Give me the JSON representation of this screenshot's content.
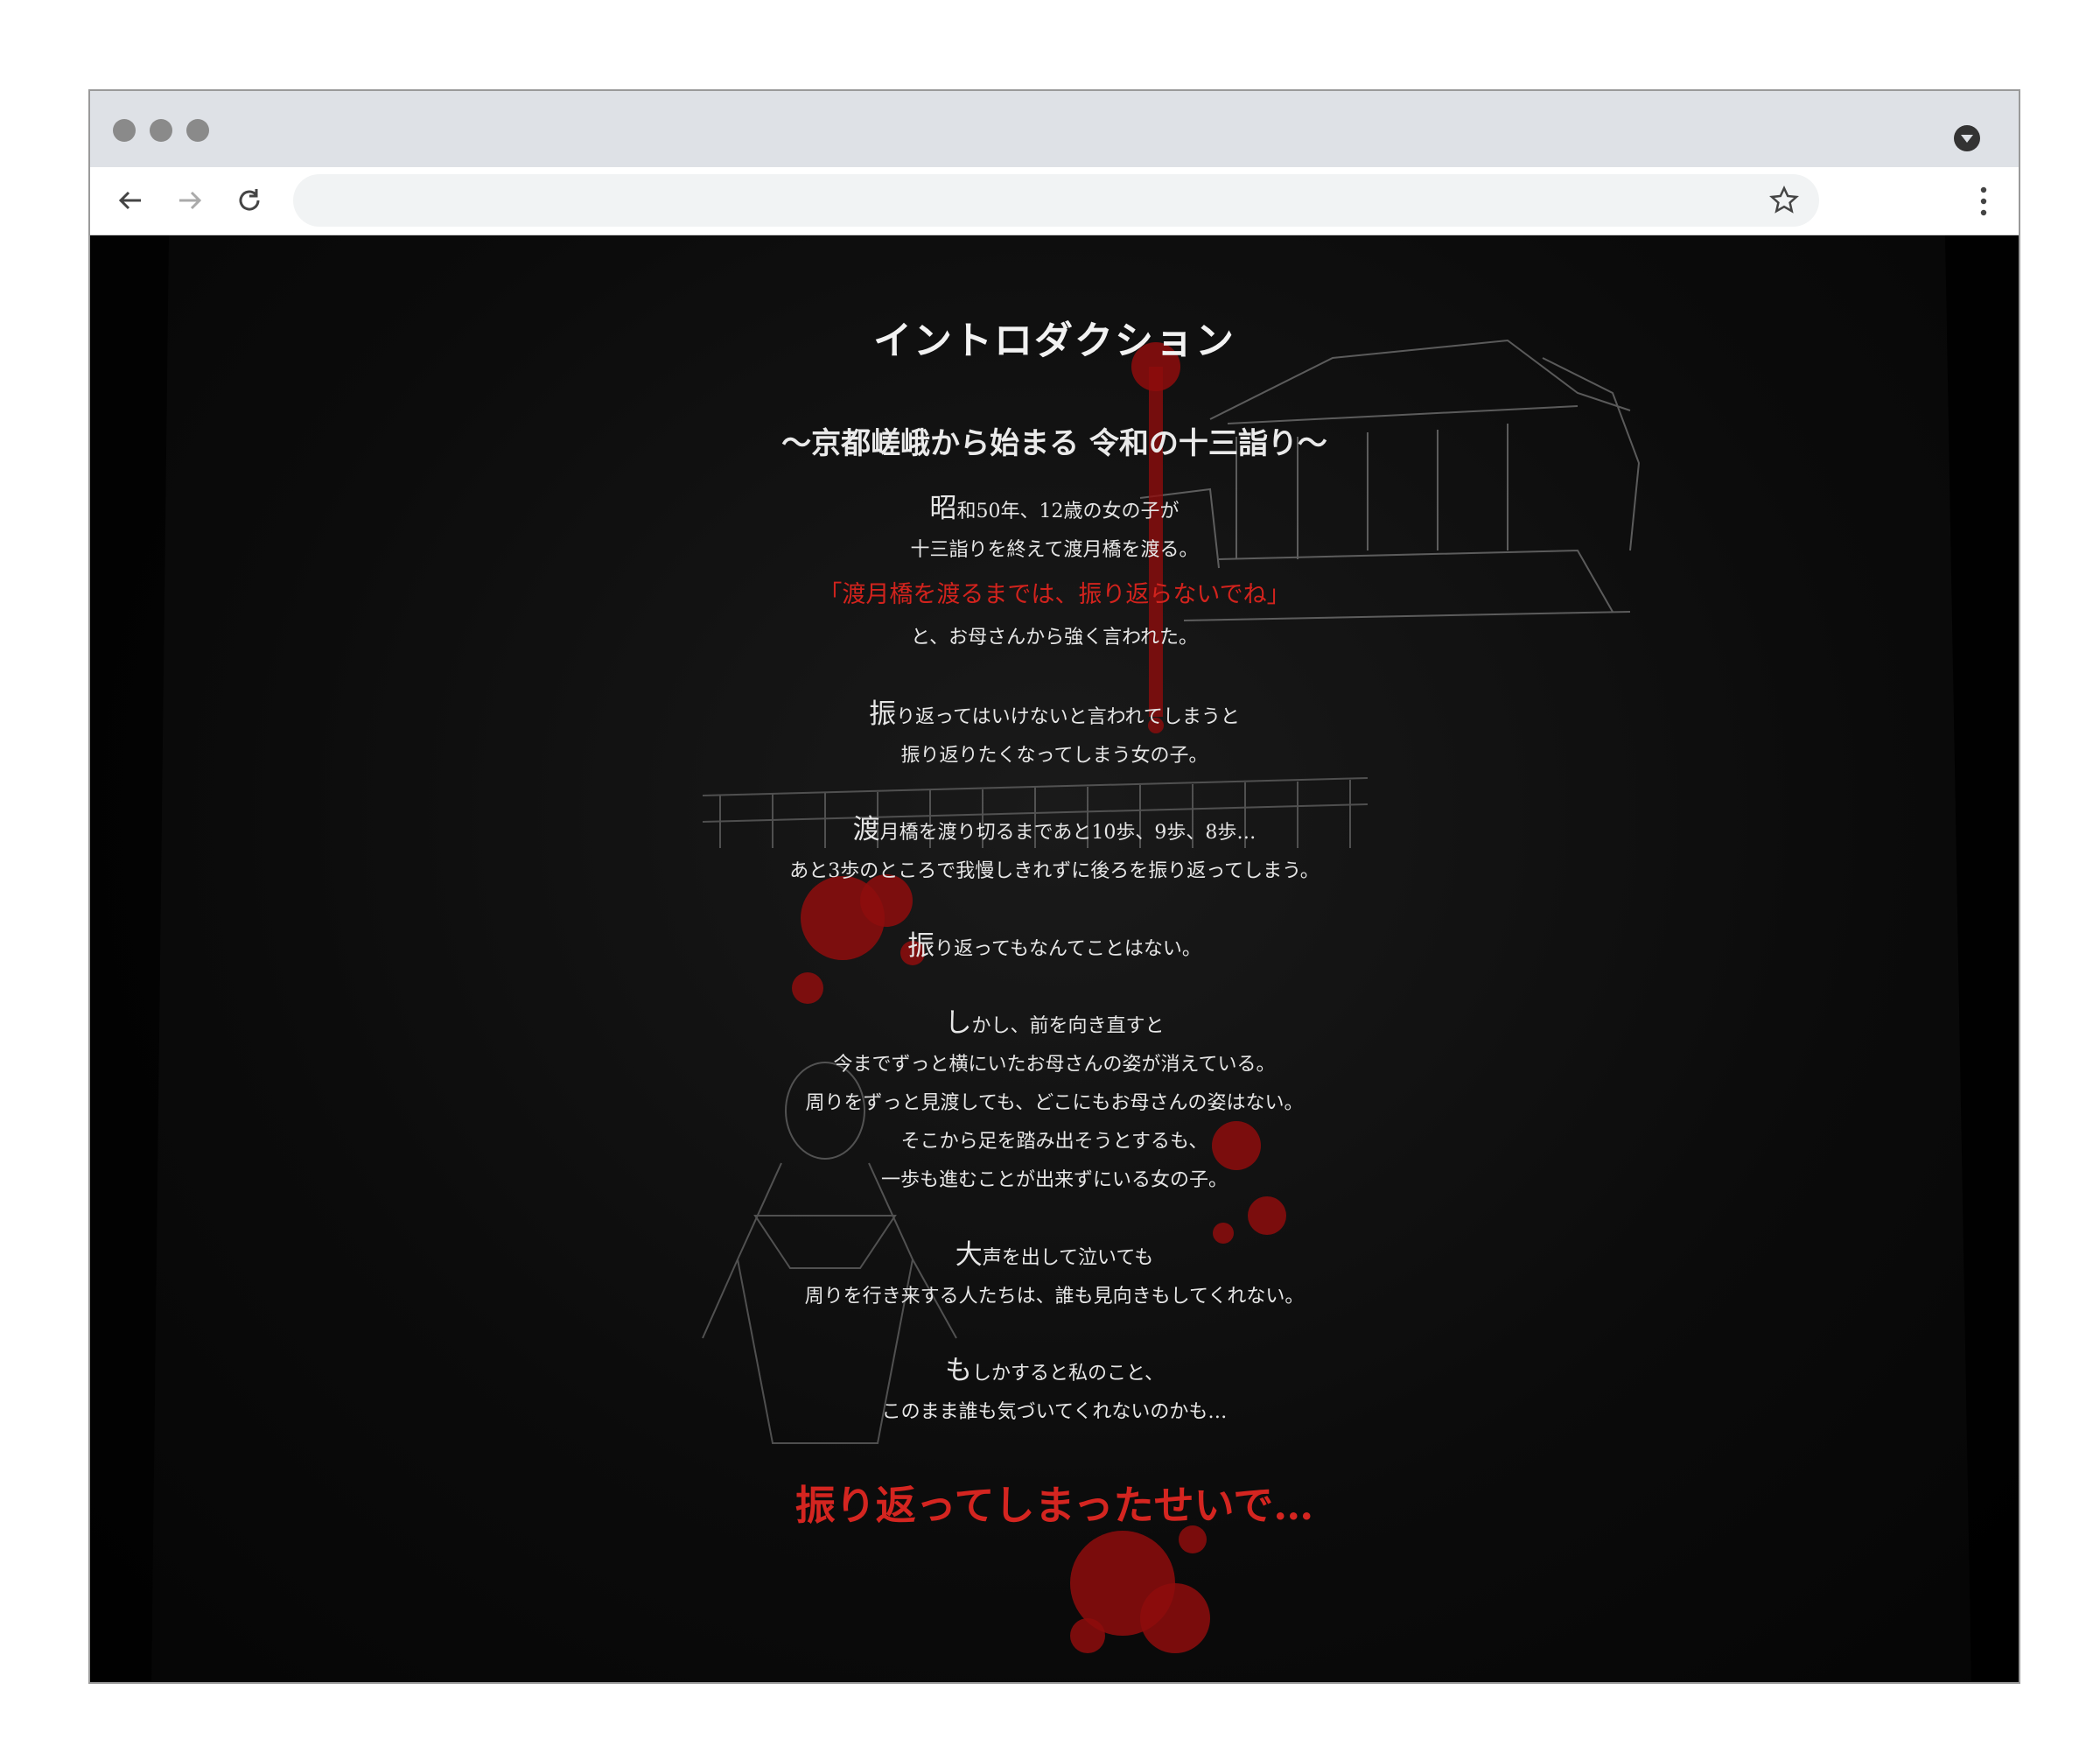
{
  "browser": {
    "url": ""
  },
  "page": {
    "heading": "イントロダクション",
    "subheading": "〜京都嵯峨から始まる 令和の十三詣り〜",
    "stanzas": [
      {
        "first": "昭",
        "rest": "和50年、12歳の女の子が",
        "line2": "十三詣りを終えて渡月橋を渡る。"
      },
      {
        "red": "「渡月橋を渡るまでは、振り返らないでね」"
      },
      {
        "line": "と、お母さんから強く言われた。"
      },
      {
        "first": "振",
        "rest": "り返ってはいけないと言われてしまうと",
        "line2": "振り返りたくなってしまう女の子。"
      },
      {
        "first": "渡",
        "rest": "月橋を渡り切るまであと10歩、9歩、8歩…",
        "line2": "あと3歩のところで我慢しきれずに後ろを振り返ってしまう。"
      },
      {
        "first": "振",
        "rest": "り返ってもなんてことはない。"
      },
      {
        "first": "し",
        "rest": "かし、前を向き直すと",
        "lines": [
          "今までずっと横にいたお母さんの姿が消えている。",
          "周りをずっと見渡しても、どこにもお母さんの姿はない。",
          "そこから足を踏み出そうとするも、",
          "一歩も進むことが出来ずにいる女の子。"
        ]
      },
      {
        "first": "大",
        "rest": "声を出して泣いても",
        "line2": "周りを行き来する人たちは、誰も見向きもしてくれない。"
      },
      {
        "first": "も",
        "rest": "しかすると私のこと、",
        "line2": "このまま誰も気づいてくれないのかも…"
      }
    ],
    "closing": "振り返ってしまったせいで…"
  },
  "colors": {
    "background": "#0b0b0b",
    "text": "#e6e6e6",
    "accent_red": "#d2231d",
    "chrome": "#dee1e6"
  }
}
